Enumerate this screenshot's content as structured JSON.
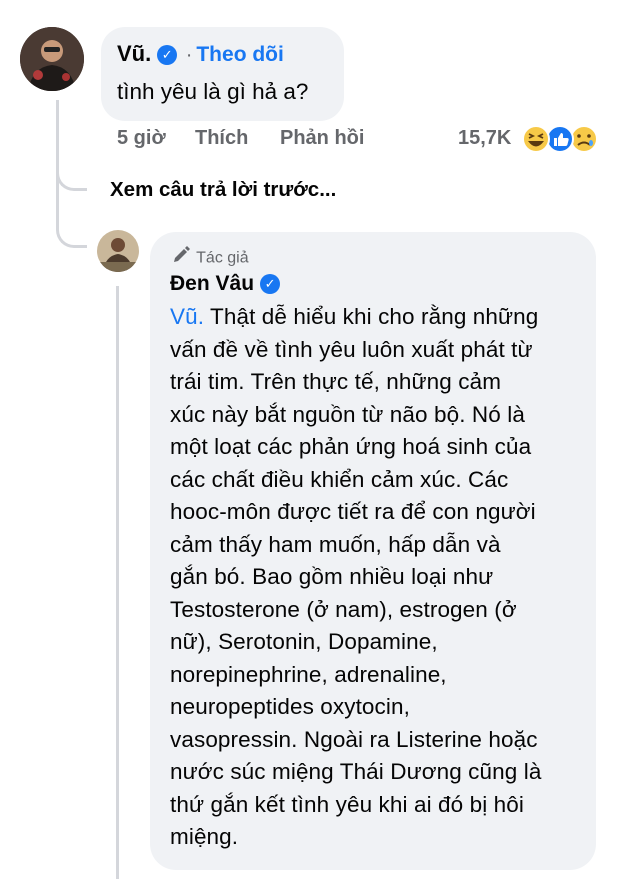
{
  "comment": {
    "author": "Vũ.",
    "follow_sep": "·",
    "follow_label": "Theo dõi",
    "text": "tình yêu là gì hả a?",
    "time": "5 giờ",
    "like_label": "Thích",
    "reply_label": "Phản hồi",
    "reaction_count": "15,7K"
  },
  "view_previous": "Xem câu trả lời trước...",
  "reply": {
    "author_badge": "Tác giả",
    "author": "Đen Vâu",
    "mention": "Vũ.",
    "lines": [
      " Thật dễ hiểu khi cho rằng những",
      "vấn đề về tình yêu luôn xuất phát từ",
      "trái tim. Trên thực tế, những cảm",
      "xúc này bắt nguồn từ não bộ. Nó là",
      "một loạt các phản ứng hoá sinh của",
      "các chất điều khiển cảm xúc. Các",
      "hooc-môn được tiết ra để con người",
      "cảm thấy ham muốn, hấp dẫn và",
      "gắn bó. Bao gồm nhiều loại như",
      "Testosterone (ở nam), estrogen (ở",
      "nữ), Serotonin, Dopamine,",
      "norepinephrine, adrenaline,",
      "neuropeptides oxytocin,",
      "vasopressin. Ngoài ra Listerine hoặc",
      "nước súc miệng Thái Dương cũng là",
      "thứ gắn kết tình yêu khi ai đó bị hôi",
      "miệng."
    ]
  },
  "icons": {
    "verified": "verified-check-icon",
    "author_badge": "pencil-icon",
    "reactions": [
      "haha-reaction-icon",
      "like-reaction-icon",
      "sad-reaction-icon"
    ]
  },
  "colors": {
    "accent": "#1877f2",
    "bubble": "#f0f2f5",
    "meta": "#65676b"
  }
}
